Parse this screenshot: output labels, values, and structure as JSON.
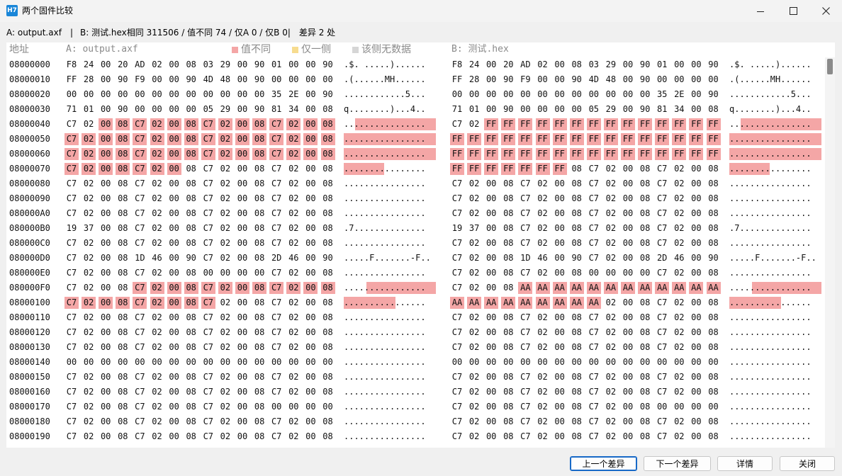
{
  "window": {
    "title": "两个固件比较",
    "icon_text": "H7"
  },
  "summary": {
    "a_file": "A: output.axf",
    "separator": "|",
    "b_info": "B: 测试.hex相同 311506 / 值不同 74 / 仅A 0 / 仅B 0|",
    "diff_count": "差异 2 处"
  },
  "header": {
    "address": "地址",
    "col_a": "A: output.axf",
    "col_b": "B: 测试.hex",
    "legend": [
      {
        "label": "值不同",
        "color": "#f4a6a6"
      },
      {
        "label": "仅一侧",
        "color": "#f7dc8f"
      },
      {
        "label": "该侧无数据",
        "color": "#d6d6d6"
      }
    ]
  },
  "colors": {
    "diff": "#f4a6a6"
  },
  "rows": [
    {
      "addr": "08000000",
      "a": "F8 24 00 20 AD 02 00 08 03 29 00 90 01 00 00 90",
      "a_ascii": ".$. .....)......",
      "b": "F8 24 00 20 AD 02 00 08 03 29 00 90 01 00 00 90",
      "b_ascii": ".$. .....)......",
      "diff": []
    },
    {
      "addr": "08000010",
      "a": "FF 28 00 90 F9 00 00 90 4D 48 00 90 00 00 00 00",
      "a_ascii": ".(......MH......",
      "b": "FF 28 00 90 F9 00 00 90 4D 48 00 90 00 00 00 00",
      "b_ascii": ".(......MH......",
      "diff": []
    },
    {
      "addr": "08000020",
      "a": "00 00 00 00 00 00 00 00 00 00 00 00 35 2E 00 90",
      "a_ascii": "............5...",
      "b": "00 00 00 00 00 00 00 00 00 00 00 00 35 2E 00 90",
      "b_ascii": "............5...",
      "diff": []
    },
    {
      "addr": "08000030",
      "a": "71 01 00 90 00 00 00 00 05 29 00 90 81 34 00 08",
      "a_ascii": "q........)...4..",
      "b": "71 01 00 90 00 00 00 00 05 29 00 90 81 34 00 08",
      "b_ascii": "q........)...4..",
      "diff": []
    },
    {
      "addr": "08000040",
      "a": "C7 02 00 08 C7 02 00 08 C7 02 00 08 C7 02 00 08",
      "a_ascii": "................",
      "b": "C7 02 FF FF FF FF FF FF FF FF FF FF FF FF FF FF",
      "b_ascii": "................",
      "diff": [
        2,
        3,
        4,
        5,
        6,
        7,
        8,
        9,
        10,
        11,
        12,
        13,
        14,
        15
      ]
    },
    {
      "addr": "08000050",
      "a": "C7 02 00 08 C7 02 00 08 C7 02 00 08 C7 02 00 08",
      "a_ascii": "................",
      "b": "FF FF FF FF FF FF FF FF FF FF FF FF FF FF FF FF",
      "b_ascii": "................",
      "diff": [
        0,
        1,
        2,
        3,
        4,
        5,
        6,
        7,
        8,
        9,
        10,
        11,
        12,
        13,
        14,
        15
      ]
    },
    {
      "addr": "08000060",
      "a": "C7 02 00 08 C7 02 00 08 C7 02 00 08 C7 02 00 08",
      "a_ascii": "................",
      "b": "FF FF FF FF FF FF FF FF FF FF FF FF FF FF FF FF",
      "b_ascii": "................",
      "diff": [
        0,
        1,
        2,
        3,
        4,
        5,
        6,
        7,
        8,
        9,
        10,
        11,
        12,
        13,
        14,
        15
      ]
    },
    {
      "addr": "08000070",
      "a": "C7 02 00 08 C7 02 00 08 C7 02 00 08 C7 02 00 08",
      "a_ascii": "................",
      "b": "FF FF FF FF FF FF FF 08 C7 02 00 08 C7 02 00 08",
      "b_ascii": "................",
      "diff": [
        0,
        1,
        2,
        3,
        4,
        5,
        6
      ]
    },
    {
      "addr": "08000080",
      "a": "C7 02 00 08 C7 02 00 08 C7 02 00 08 C7 02 00 08",
      "a_ascii": "................",
      "b": "C7 02 00 08 C7 02 00 08 C7 02 00 08 C7 02 00 08",
      "b_ascii": "................",
      "diff": []
    },
    {
      "addr": "08000090",
      "a": "C7 02 00 08 C7 02 00 08 C7 02 00 08 C7 02 00 08",
      "a_ascii": "................",
      "b": "C7 02 00 08 C7 02 00 08 C7 02 00 08 C7 02 00 08",
      "b_ascii": "................",
      "diff": []
    },
    {
      "addr": "080000A0",
      "a": "C7 02 00 08 C7 02 00 08 C7 02 00 08 C7 02 00 08",
      "a_ascii": "................",
      "b": "C7 02 00 08 C7 02 00 08 C7 02 00 08 C7 02 00 08",
      "b_ascii": "................",
      "diff": []
    },
    {
      "addr": "080000B0",
      "a": "19 37 00 08 C7 02 00 08 C7 02 00 08 C7 02 00 08",
      "a_ascii": ".7..............",
      "b": "19 37 00 08 C7 02 00 08 C7 02 00 08 C7 02 00 08",
      "b_ascii": ".7..............",
      "diff": []
    },
    {
      "addr": "080000C0",
      "a": "C7 02 00 08 C7 02 00 08 C7 02 00 08 C7 02 00 08",
      "a_ascii": "................",
      "b": "C7 02 00 08 C7 02 00 08 C7 02 00 08 C7 02 00 08",
      "b_ascii": "................",
      "diff": []
    },
    {
      "addr": "080000D0",
      "a": "C7 02 00 08 1D 46 00 90 C7 02 00 08 2D 46 00 90",
      "a_ascii": ".....F.......-F..",
      "b": "C7 02 00 08 1D 46 00 90 C7 02 00 08 2D 46 00 90",
      "b_ascii": ".....F.......-F..",
      "diff": []
    },
    {
      "addr": "080000E0",
      "a": "C7 02 00 08 C7 02 00 08 00 00 00 00 C7 02 00 08",
      "a_ascii": "................",
      "b": "C7 02 00 08 C7 02 00 08 00 00 00 00 C7 02 00 08",
      "b_ascii": "................",
      "diff": []
    },
    {
      "addr": "080000F0",
      "a": "C7 02 00 08 C7 02 00 08 C7 02 00 08 C7 02 00 08",
      "a_ascii": "................",
      "b": "C7 02 00 08 AA AA AA AA AA AA AA AA AA AA AA AA",
      "b_ascii": "................",
      "diff": [
        4,
        5,
        6,
        7,
        8,
        9,
        10,
        11,
        12,
        13,
        14,
        15
      ]
    },
    {
      "addr": "08000100",
      "a": "C7 02 00 08 C7 02 00 08 C7 02 00 08 C7 02 00 08",
      "a_ascii": "................",
      "b": "AA AA AA AA AA AA AA AA AA 02 00 08 C7 02 00 08",
      "b_ascii": "................",
      "diff": [
        0,
        1,
        2,
        3,
        4,
        5,
        6,
        7,
        8
      ]
    },
    {
      "addr": "08000110",
      "a": "C7 02 00 08 C7 02 00 08 C7 02 00 08 C7 02 00 08",
      "a_ascii": "................",
      "b": "C7 02 00 08 C7 02 00 08 C7 02 00 08 C7 02 00 08",
      "b_ascii": "................",
      "diff": []
    },
    {
      "addr": "08000120",
      "a": "C7 02 00 08 C7 02 00 08 C7 02 00 08 C7 02 00 08",
      "a_ascii": "................",
      "b": "C7 02 00 08 C7 02 00 08 C7 02 00 08 C7 02 00 08",
      "b_ascii": "................",
      "diff": []
    },
    {
      "addr": "08000130",
      "a": "C7 02 00 08 C7 02 00 08 C7 02 00 08 C7 02 00 08",
      "a_ascii": "................",
      "b": "C7 02 00 08 C7 02 00 08 C7 02 00 08 C7 02 00 08",
      "b_ascii": "................",
      "diff": []
    },
    {
      "addr": "08000140",
      "a": "00 00 00 00 00 00 00 00 00 00 00 00 00 00 00 00",
      "a_ascii": "................",
      "b": "00 00 00 00 00 00 00 00 00 00 00 00 00 00 00 00",
      "b_ascii": "................",
      "diff": []
    },
    {
      "addr": "08000150",
      "a": "C7 02 00 08 C7 02 00 08 C7 02 00 08 C7 02 00 08",
      "a_ascii": "................",
      "b": "C7 02 00 08 C7 02 00 08 C7 02 00 08 C7 02 00 08",
      "b_ascii": "................",
      "diff": []
    },
    {
      "addr": "08000160",
      "a": "C7 02 00 08 C7 02 00 08 C7 02 00 08 C7 02 00 08",
      "a_ascii": "................",
      "b": "C7 02 00 08 C7 02 00 08 C7 02 00 08 C7 02 00 08",
      "b_ascii": "................",
      "diff": []
    },
    {
      "addr": "08000170",
      "a": "C7 02 00 08 C7 02 00 08 C7 02 00 08 00 00 00 00",
      "a_ascii": "................",
      "b": "C7 02 00 08 C7 02 00 08 C7 02 00 08 00 00 00 00",
      "b_ascii": "................",
      "diff": []
    },
    {
      "addr": "08000180",
      "a": "C7 02 00 08 C7 02 00 08 C7 02 00 08 C7 02 00 08",
      "a_ascii": "................",
      "b": "C7 02 00 08 C7 02 00 08 C7 02 00 08 C7 02 00 08",
      "b_ascii": "................",
      "diff": []
    },
    {
      "addr": "08000190",
      "a": "C7 02 00 08 C7 02 00 08 C7 02 00 08 C7 02 00 08",
      "a_ascii": "................",
      "b": "C7 02 00 08 C7 02 00 08 C7 02 00 08 C7 02 00 08",
      "b_ascii": "................",
      "diff": []
    }
  ],
  "buttons": {
    "prev": "上一个差异",
    "next": "下一个差异",
    "details": "详情",
    "close": "关闭"
  }
}
